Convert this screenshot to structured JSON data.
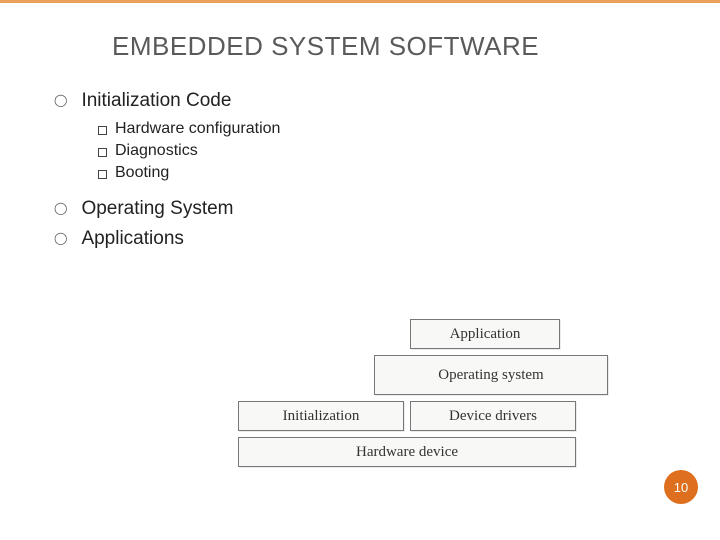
{
  "title": "EMBEDDED SYSTEM SOFTWARE",
  "bullets": {
    "item0": {
      "label": "Initialization Code"
    },
    "sub0": {
      "label": "Hardware configuration"
    },
    "sub1": {
      "label": "Diagnostics"
    },
    "sub2": {
      "label": "Booting"
    },
    "item1": {
      "label": "Operating System"
    },
    "item2": {
      "label": "Applications"
    }
  },
  "diagram": {
    "application": "Application",
    "os": "Operating system",
    "initialization": "Initialization",
    "device_drivers": "Device drivers",
    "hardware_device": "Hardware device"
  },
  "page_number": "10"
}
